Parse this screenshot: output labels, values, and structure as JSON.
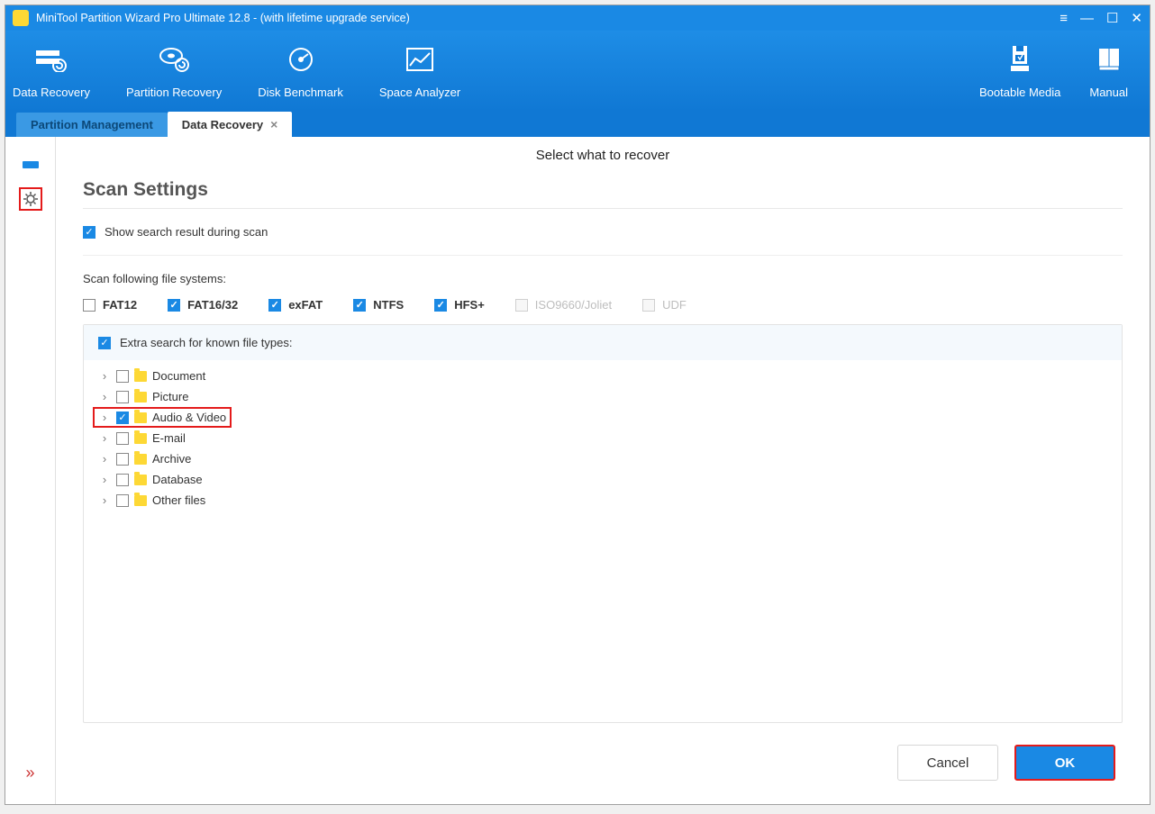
{
  "window": {
    "title": "MiniTool Partition Wizard Pro Ultimate 12.8 - (with lifetime upgrade service)"
  },
  "toolbar": {
    "items": [
      {
        "label": "Data Recovery"
      },
      {
        "label": "Partition Recovery"
      },
      {
        "label": "Disk Benchmark"
      },
      {
        "label": "Space Analyzer"
      }
    ],
    "right": [
      {
        "label": "Bootable Media"
      },
      {
        "label": "Manual"
      }
    ]
  },
  "tabs": {
    "inactive": "Partition Management",
    "active": "Data Recovery"
  },
  "page": {
    "title": "Select what to recover",
    "section_title": "Scan Settings",
    "show_result_label": "Show search result during scan",
    "fs_label": "Scan following file systems:",
    "fs": {
      "fat12": "FAT12",
      "fat16": "FAT16/32",
      "exfat": "exFAT",
      "ntfs": "NTFS",
      "hfs": "HFS+",
      "iso": "ISO9660/Joliet",
      "udf": "UDF"
    },
    "extra_label": "Extra search for known file types:",
    "tree": {
      "document": "Document",
      "picture": "Picture",
      "audio_video": "Audio & Video",
      "email": "E-mail",
      "archive": "Archive",
      "database": "Database",
      "other": "Other files"
    },
    "buttons": {
      "cancel": "Cancel",
      "ok": "OK"
    }
  }
}
